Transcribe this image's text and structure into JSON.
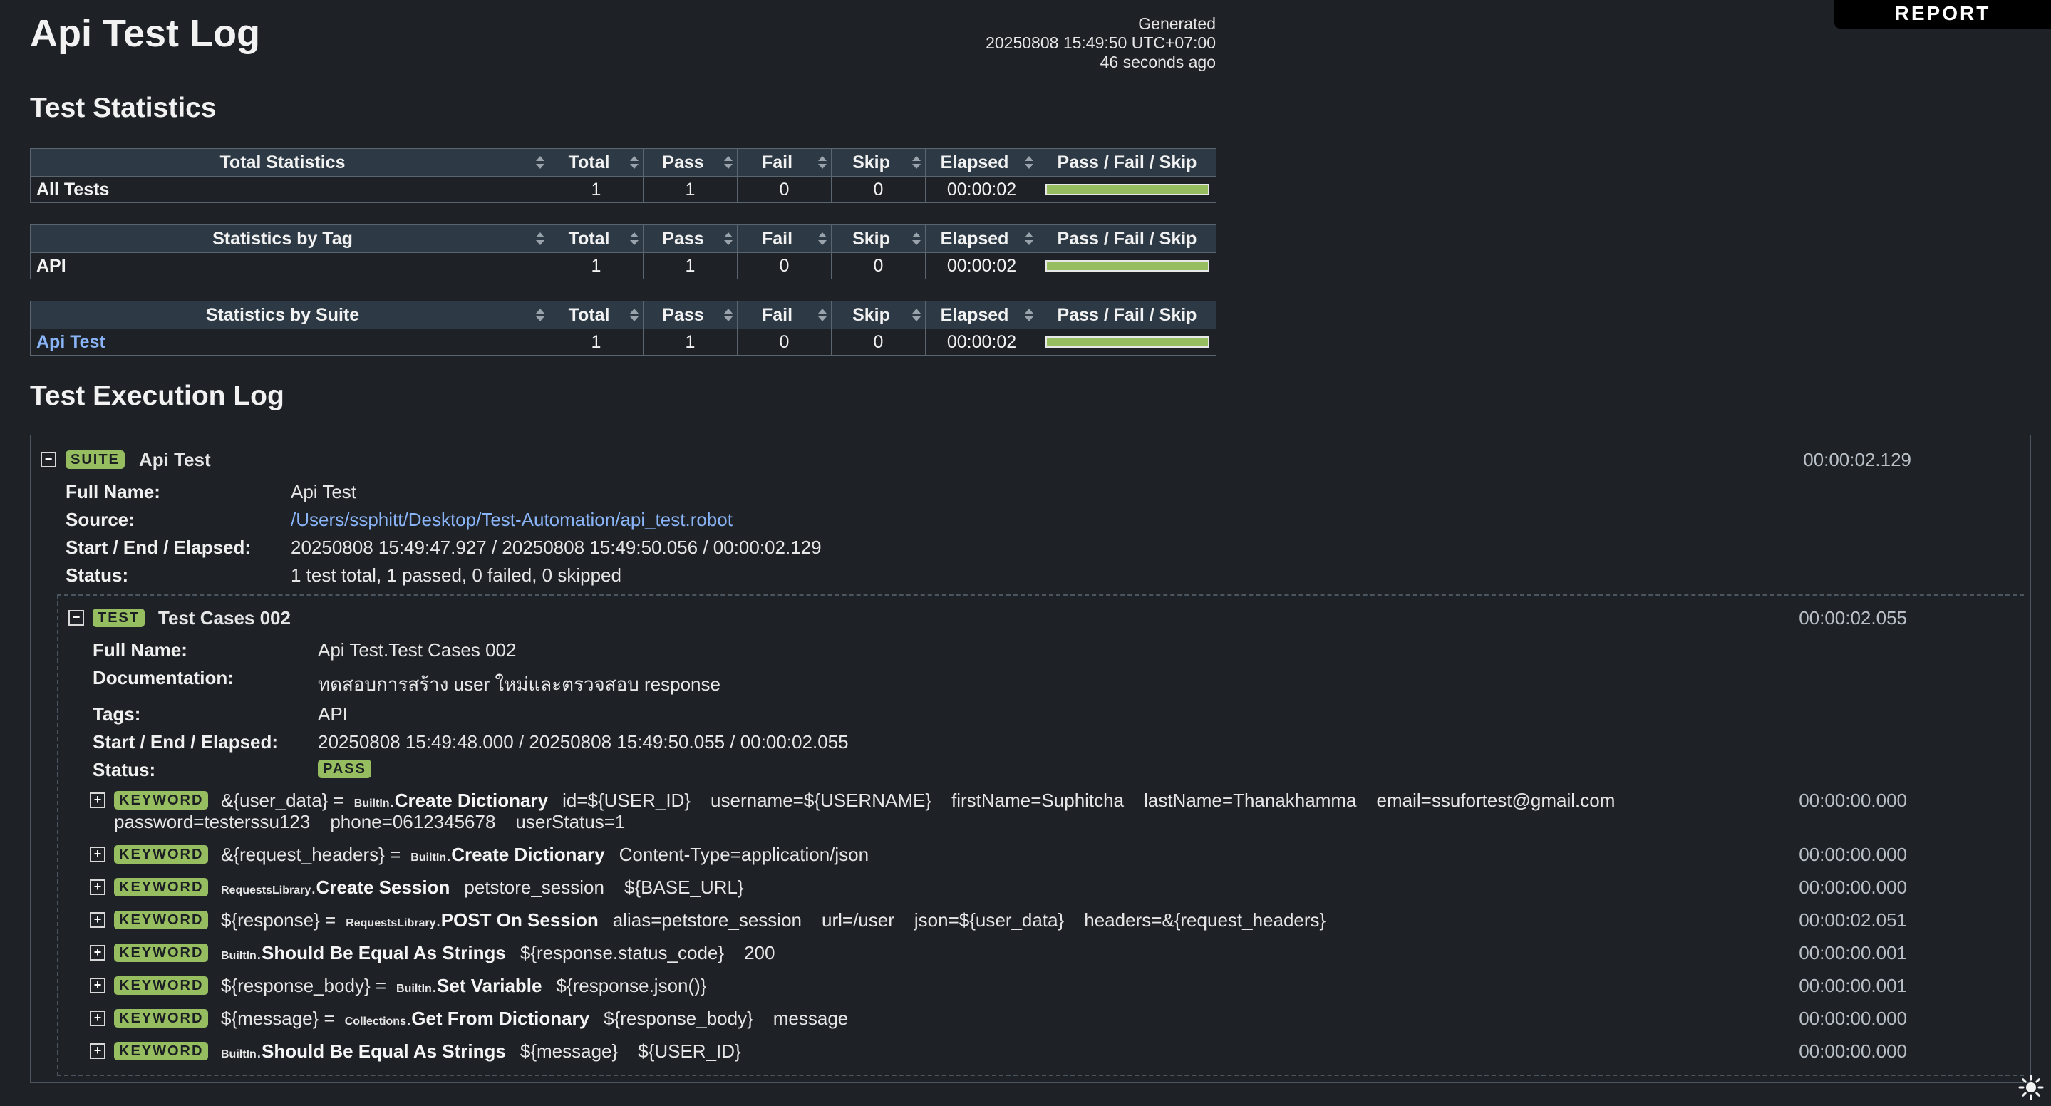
{
  "header": {
    "title": "Api Test Log",
    "report_tab": "REPORT",
    "generated_label": "Generated",
    "generated_time": "20250808 15:49:50 UTC+07:00",
    "generated_ago": "46 seconds ago"
  },
  "statistics": {
    "heading": "Test Statistics",
    "columns": [
      "Total",
      "Pass",
      "Fail",
      "Skip",
      "Elapsed",
      "Pass / Fail / Skip"
    ],
    "tables": [
      {
        "title": "Total Statistics",
        "name": "All Tests",
        "total": "1",
        "pass": "1",
        "fail": "0",
        "skip": "0",
        "elapsed": "00:00:02",
        "pass_ratio": 1.0
      },
      {
        "title": "Statistics by Tag",
        "name": "API",
        "total": "1",
        "pass": "1",
        "fail": "0",
        "skip": "0",
        "elapsed": "00:00:02",
        "pass_ratio": 1.0
      },
      {
        "title": "Statistics by Suite",
        "name": "Api Test",
        "total": "1",
        "pass": "1",
        "fail": "0",
        "skip": "0",
        "elapsed": "00:00:02",
        "pass_ratio": 1.0
      }
    ]
  },
  "log": {
    "heading": "Test Execution Log",
    "suite": {
      "label": "SUITE",
      "name": "Api Test",
      "elapsed": "00:00:02.129",
      "fields": {
        "full_name_label": "Full Name:",
        "full_name": "Api Test",
        "source_label": "Source:",
        "source": "/Users/ssphitt/Desktop/Test-Automation/api_test.robot",
        "times_label": "Start / End / Elapsed:",
        "times": "20250808 15:49:47.927 / 20250808 15:49:50.056 / 00:00:02.129",
        "status_label": "Status:",
        "status": "1 test total, 1 passed, 0 failed, 0 skipped"
      }
    },
    "test": {
      "label": "TEST",
      "name": "Test Cases 002",
      "elapsed": "00:00:02.055",
      "fields": {
        "full_name_label": "Full Name:",
        "full_name": "Api Test.Test Cases 002",
        "doc_label": "Documentation:",
        "doc": "ทดสอบการสร้าง user ใหม่และตรวจสอบ response",
        "tags_label": "Tags:",
        "tags": "API",
        "times_label": "Start / End / Elapsed:",
        "times": "20250808 15:49:48.000 / 20250808 15:49:50.055 / 00:00:02.055",
        "status_label": "Status:",
        "status": "PASS"
      }
    },
    "keyword_label": "KEYWORD",
    "keywords": [
      {
        "assign": "&{user_data} =",
        "lib": "BuiltIn",
        "name": "Create Dictionary",
        "args": [
          "id=${USER_ID}",
          "username=${USERNAME}",
          "firstName=Suphitcha",
          "lastName=Thanakhamma",
          "email=ssufortest@gmail.com"
        ],
        "args2": [
          "password=testerssu123",
          "phone=0612345678",
          "userStatus=1"
        ],
        "elapsed": "00:00:00.000"
      },
      {
        "assign": "&{request_headers} =",
        "lib": "BuiltIn",
        "name": "Create Dictionary",
        "args": [
          "Content-Type=application/json"
        ],
        "elapsed": "00:00:00.000"
      },
      {
        "assign": "",
        "lib": "RequestsLibrary",
        "name": "Create Session",
        "args": [
          "petstore_session",
          "${BASE_URL}"
        ],
        "elapsed": "00:00:00.000"
      },
      {
        "assign": "${response} =",
        "lib": "RequestsLibrary",
        "name": "POST On Session",
        "args": [
          "alias=petstore_session",
          "url=/user",
          "json=${user_data}",
          "headers=&{request_headers}"
        ],
        "elapsed": "00:00:02.051"
      },
      {
        "assign": "",
        "lib": "BuiltIn",
        "name": "Should Be Equal As Strings",
        "args": [
          "${response.status_code}",
          "200"
        ],
        "elapsed": "00:00:00.001"
      },
      {
        "assign": "${response_body} =",
        "lib": "BuiltIn",
        "name": "Set Variable",
        "args": [
          "${response.json()}"
        ],
        "elapsed": "00:00:00.001"
      },
      {
        "assign": "${message} =",
        "lib": "Collections",
        "name": "Get From Dictionary",
        "args": [
          "${response_body}",
          "message"
        ],
        "elapsed": "00:00:00.000"
      },
      {
        "assign": "",
        "lib": "BuiltIn",
        "name": "Should Be Equal As Strings",
        "args": [
          "${message}",
          "${USER_ID}"
        ],
        "elapsed": "00:00:00.000"
      }
    ]
  },
  "colors": {
    "background": "#1e2226",
    "pass": "#97bd61",
    "header": "#2d3a45",
    "link": "#8ab4f8"
  }
}
